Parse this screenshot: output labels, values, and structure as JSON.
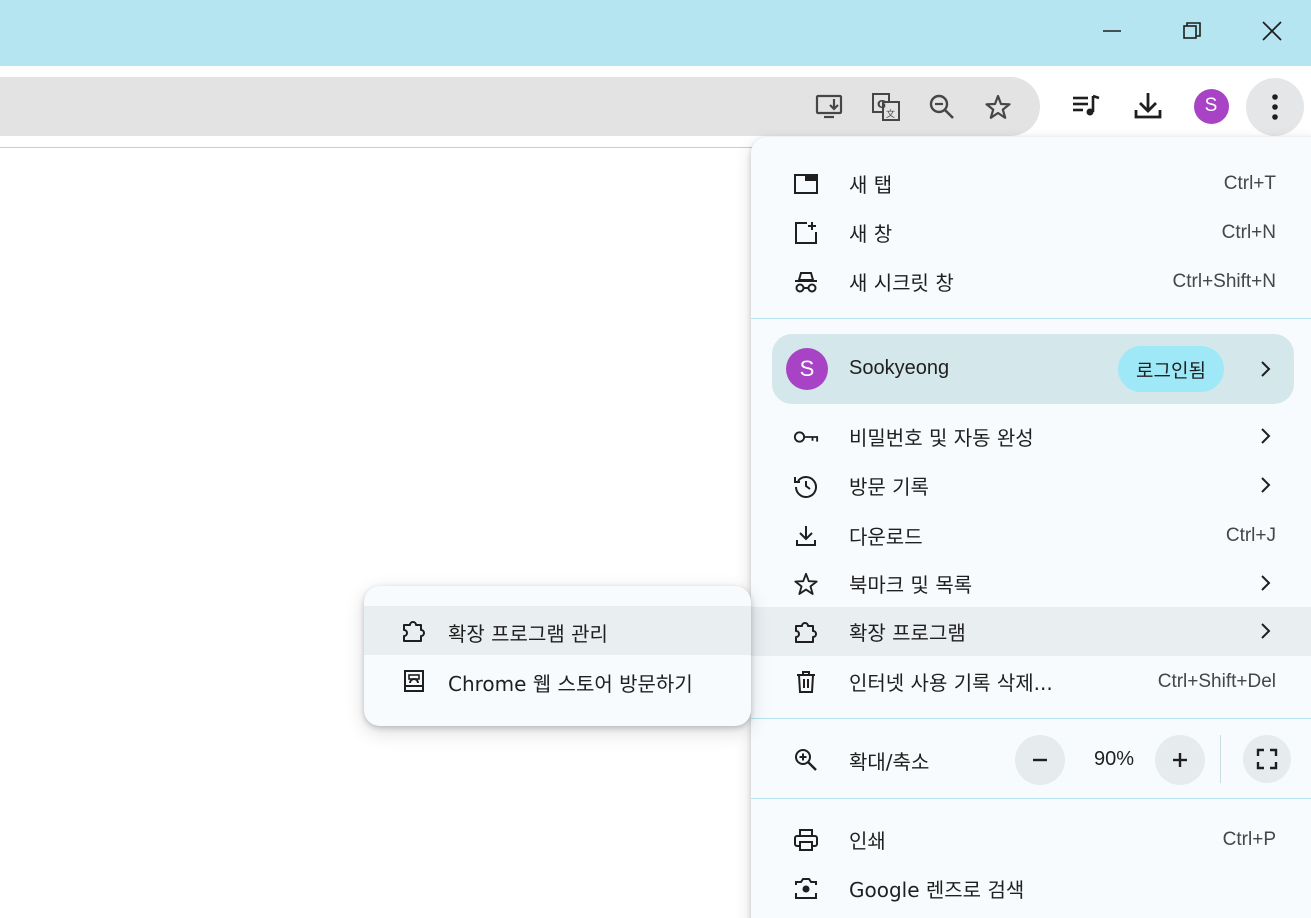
{
  "colors": {
    "titlebar": "#b4e5f1",
    "accent": "#a943c6",
    "menu_bg": "#f7fbfd",
    "highlight": "#e9eef1",
    "profile_bg": "#d4e8eb",
    "badge_bg": "#9fe8f8"
  },
  "window": {
    "minimize_icon": "minimize-icon",
    "restore_icon": "restore-icon",
    "close_icon": "close-icon"
  },
  "toolbar": {
    "profile_initial": "S",
    "icons": [
      "install-app-icon",
      "translate-icon",
      "zoom-out-icon",
      "star-icon",
      "media-queue-icon",
      "download-icon",
      "avatar",
      "more-vert-icon"
    ]
  },
  "menu": {
    "new_tab": {
      "label": "새 탭",
      "shortcut": "Ctrl+T"
    },
    "new_window": {
      "label": "새 창",
      "shortcut": "Ctrl+N"
    },
    "incognito": {
      "label": "새 시크릿 창",
      "shortcut": "Ctrl+Shift+N"
    },
    "profile": {
      "initial": "S",
      "name": "Sookyeong",
      "status": "로그인됨"
    },
    "passwords": {
      "label": "비밀번호 및 자동 완성"
    },
    "history": {
      "label": "방문 기록"
    },
    "downloads": {
      "label": "다운로드",
      "shortcut": "Ctrl+J"
    },
    "bookmarks": {
      "label": "북마크 및 목록"
    },
    "extensions": {
      "label": "확장 프로그램"
    },
    "clear_data": {
      "label": "인터넷 사용 기록 삭제...",
      "shortcut": "Ctrl+Shift+Del"
    },
    "zoom": {
      "label": "확대/축소",
      "value": "90%"
    },
    "print": {
      "label": "인쇄",
      "shortcut": "Ctrl+P"
    },
    "lens": {
      "label": "Google 렌즈로 검색"
    }
  },
  "submenu": {
    "manage_extensions": "확장 프로그램 관리",
    "web_store": "Chrome 웹 스토어 방문하기"
  }
}
